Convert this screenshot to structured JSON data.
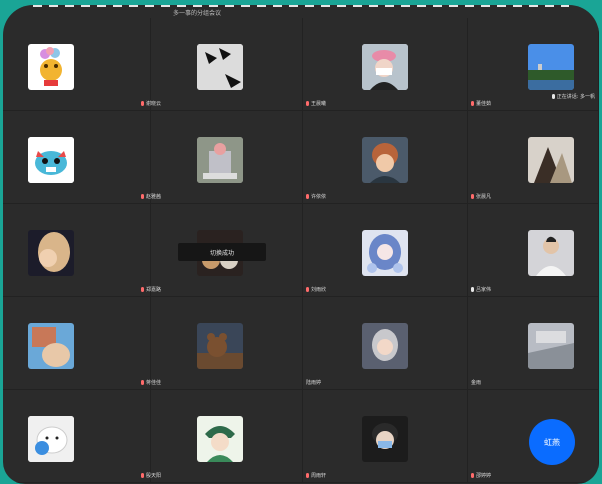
{
  "top_title": "多一事的分组会议",
  "tiles": [
    {
      "name": "",
      "mic": ""
    },
    {
      "name": "谢晓云",
      "mic": "red"
    },
    {
      "name": "王晨曦",
      "mic": "red"
    },
    {
      "name": "董佳茹",
      "mic": "red"
    },
    {
      "name": "",
      "mic": ""
    },
    {
      "name": "赵雅茜",
      "mic": "red"
    },
    {
      "name": "许依依",
      "mic": "red"
    },
    {
      "name": "张晨凡",
      "mic": "red"
    },
    {
      "name": "",
      "mic": ""
    },
    {
      "name": "郑嘉路",
      "mic": "red"
    },
    {
      "name": "刘雨欣",
      "mic": "red"
    },
    {
      "name": "吕家伟",
      "mic": "white"
    },
    {
      "name": "",
      "mic": ""
    },
    {
      "name": "蒋佳佳",
      "mic": "red"
    },
    {
      "name": "陆雨婷",
      "mic": ""
    },
    {
      "name": "金雨",
      "mic": ""
    },
    {
      "name": "",
      "mic": ""
    },
    {
      "name": "殷天阳",
      "mic": "red"
    },
    {
      "name": "周雨轩",
      "mic": "red"
    },
    {
      "name": "邵婷婷",
      "mic": "red"
    }
  ],
  "speaking_label": "正在讲话: 多一帆",
  "toast": "切换成功",
  "fab_label": "虹燕",
  "colors": {
    "accent": "#0a6cff",
    "frame_bg": "#1aa596",
    "tile_bg": "#2b2b2b"
  }
}
